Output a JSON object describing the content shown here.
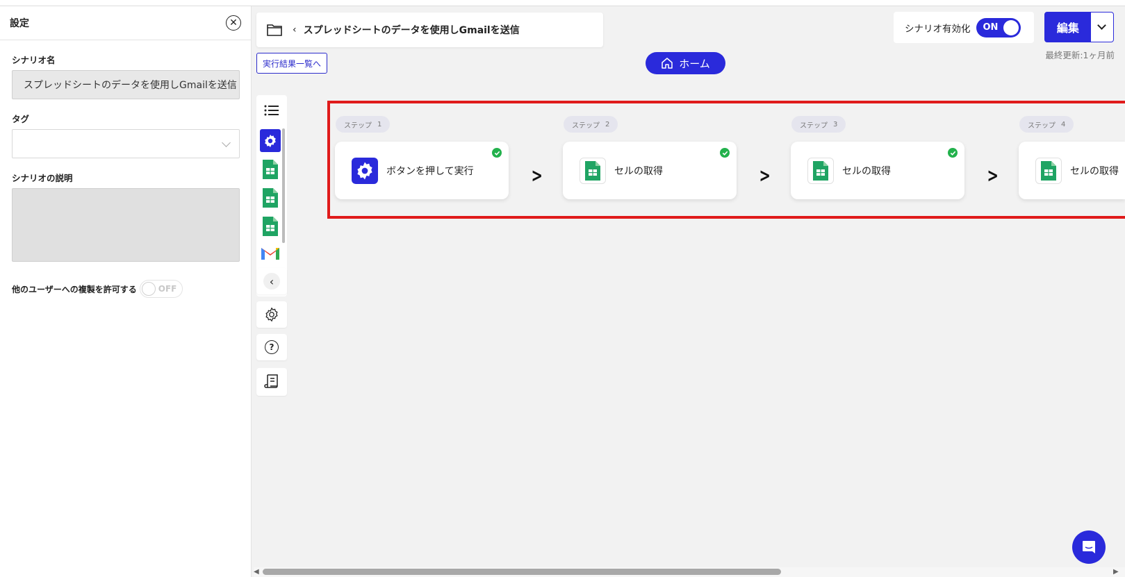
{
  "settings": {
    "title": "設定",
    "scenario_name_label": "シナリオ名",
    "scenario_name_value": "スプレッドシートのデータを使用しGmailを送信",
    "tag_label": "タグ",
    "description_label": "シナリオの説明",
    "copy_permission_label": "他のユーザーへの複製を許可する",
    "copy_toggle_text": "OFF"
  },
  "header": {
    "breadcrumb_title": "スプレッドシートのデータを使用しGmailを送信",
    "results_link": "実行結果一覧へ",
    "home_label": "ホーム",
    "enable_label": "シナリオ有効化",
    "enable_toggle_text": "ON",
    "edit_label": "編集",
    "last_updated": "最終更新:1ヶ月前"
  },
  "steps": [
    {
      "badge": "ステップ",
      "number": "1",
      "label": "ボタンを押して実行",
      "icon": "gear-icon"
    },
    {
      "badge": "ステップ",
      "number": "2",
      "label": "セルの取得",
      "icon": "sheets-icon"
    },
    {
      "badge": "ステップ",
      "number": "3",
      "label": "セルの取得",
      "icon": "sheets-icon"
    },
    {
      "badge": "ステップ",
      "number": "4",
      "label": "セルの取得",
      "icon": "sheets-icon"
    }
  ],
  "colors": {
    "accent": "#2a2adb",
    "sheets_green": "#1fa463",
    "check_green": "#22b14c",
    "highlight_red": "#e01b1b"
  }
}
